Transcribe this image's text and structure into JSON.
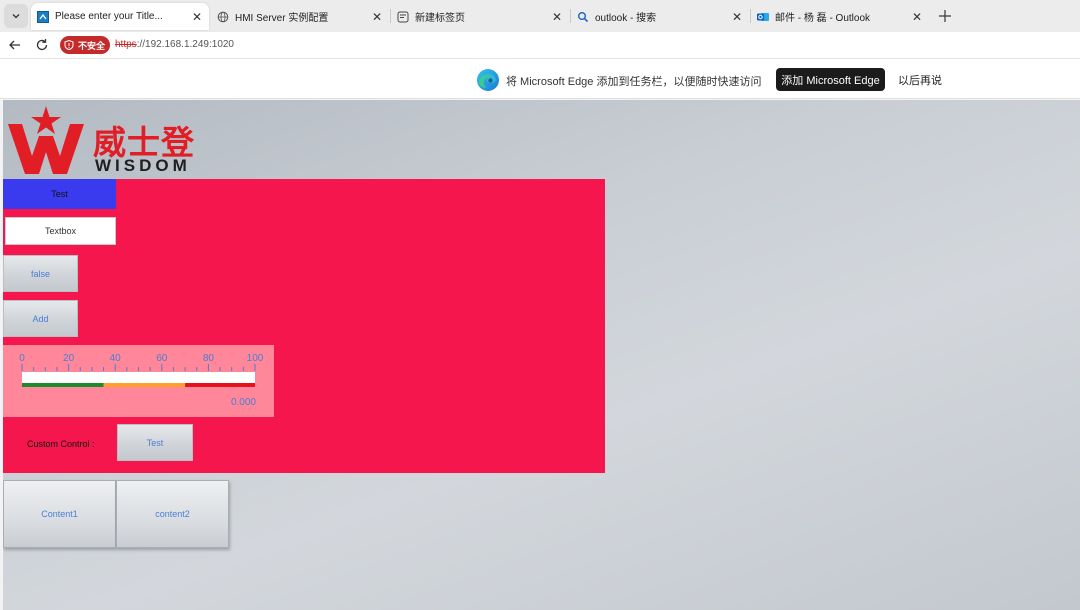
{
  "browser": {
    "tabs": [
      {
        "title": "Please enter your Title...",
        "icon": "hmi-page-icon",
        "active": true
      },
      {
        "title": "HMI Server 实例配置",
        "icon": "globe-icon",
        "active": false
      },
      {
        "title": "新建标签页",
        "icon": "newtab-page-icon",
        "active": false
      },
      {
        "title": "outlook - 搜索",
        "icon": "search-icon",
        "active": false
      },
      {
        "title": "邮件 - 杨 磊 - Outlook",
        "icon": "outlook-icon",
        "active": false
      }
    ],
    "security_badge": "不安全",
    "url_protocol": "https",
    "url_rest": "://192.168.1.249:1020"
  },
  "promo": {
    "message": "将 Microsoft Edge 添加到任务栏，以便随时快速访问",
    "add_button": "添加 Microsoft Edge",
    "later_button": "以后再说"
  },
  "page": {
    "logo": {
      "cn": "威士登",
      "en": "WISDOM"
    },
    "test_button": "Test",
    "textbox_label": "Textbox",
    "false_button": "false",
    "add_button": "Add",
    "gauge": {
      "ticks": [
        "0",
        "20",
        "40",
        "60",
        "80",
        "100"
      ],
      "min": 0,
      "max": 100,
      "value_text": "0.000",
      "zones": [
        {
          "from": 0,
          "to": 35,
          "color": "#1f8a2c"
        },
        {
          "from": 35,
          "to": 70,
          "color": "#ff9f2e"
        },
        {
          "from": 70,
          "to": 100,
          "color": "#e5121c"
        }
      ]
    },
    "custom_control_label": "Custom Control :",
    "custom_test_button": "Test",
    "content_tabs": [
      "Content1",
      "content2"
    ]
  },
  "colors": {
    "panel": "#f4164c",
    "test_button": "#3a3aee",
    "gauge_bg": "#ff8799",
    "accent_text": "#4a7ed6",
    "brand_red": "#e11d25"
  }
}
